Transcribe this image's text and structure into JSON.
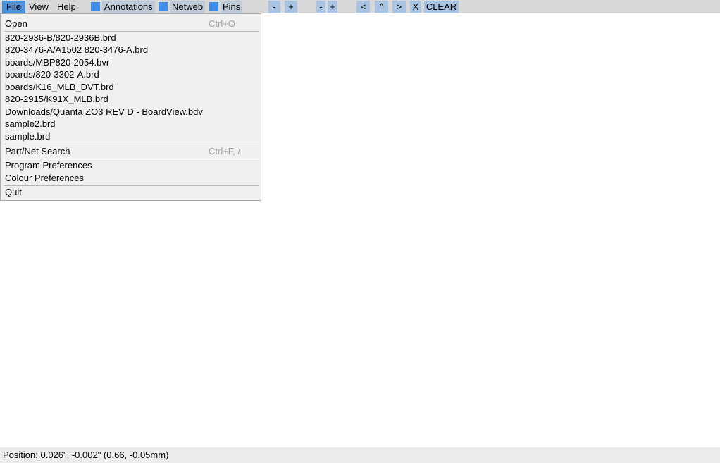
{
  "menubar": {
    "file": "File",
    "view": "View",
    "help": "Help"
  },
  "toggles": [
    {
      "label": "Annotations",
      "checked": true
    },
    {
      "label": "Netweb",
      "checked": true
    },
    {
      "label": "Pins",
      "checked": true
    }
  ],
  "toolbar": {
    "zoom_out": "-",
    "zoom_in": "+",
    "size_down": "-",
    "size_up": "+",
    "prev": "<",
    "up": "^",
    "next": ">",
    "close": "X",
    "clear": "CLEAR"
  },
  "file_menu": {
    "open": {
      "label": "Open",
      "shortcut": "Ctrl+O"
    },
    "recent": [
      "820-2936-B/820-2936B.brd",
      "820-3476-A/A1502 820-3476-A.brd",
      "boards/MBP820-2054.bvr",
      "boards/820-3302-A.brd",
      "boards/K16_MLB_DVT.brd",
      "820-2915/K91X_MLB.brd",
      "Downloads/Quanta ZO3 REV D - BoardView.bdv",
      "sample2.brd",
      "sample.brd"
    ],
    "search": {
      "label": "Part/Net Search",
      "shortcut": "Ctrl+F, /"
    },
    "program_prefs": "Program Preferences",
    "colour_prefs": "Colour Preferences",
    "quit": "Quit"
  },
  "status": {
    "position": "Position: 0.026\", -0.002\" (0.66, -0.05mm)"
  },
  "colors": {
    "menu_active": "#4a8fd9",
    "checkbox": "#3d8ee8",
    "toolbar_button": "#a9c4e2"
  }
}
